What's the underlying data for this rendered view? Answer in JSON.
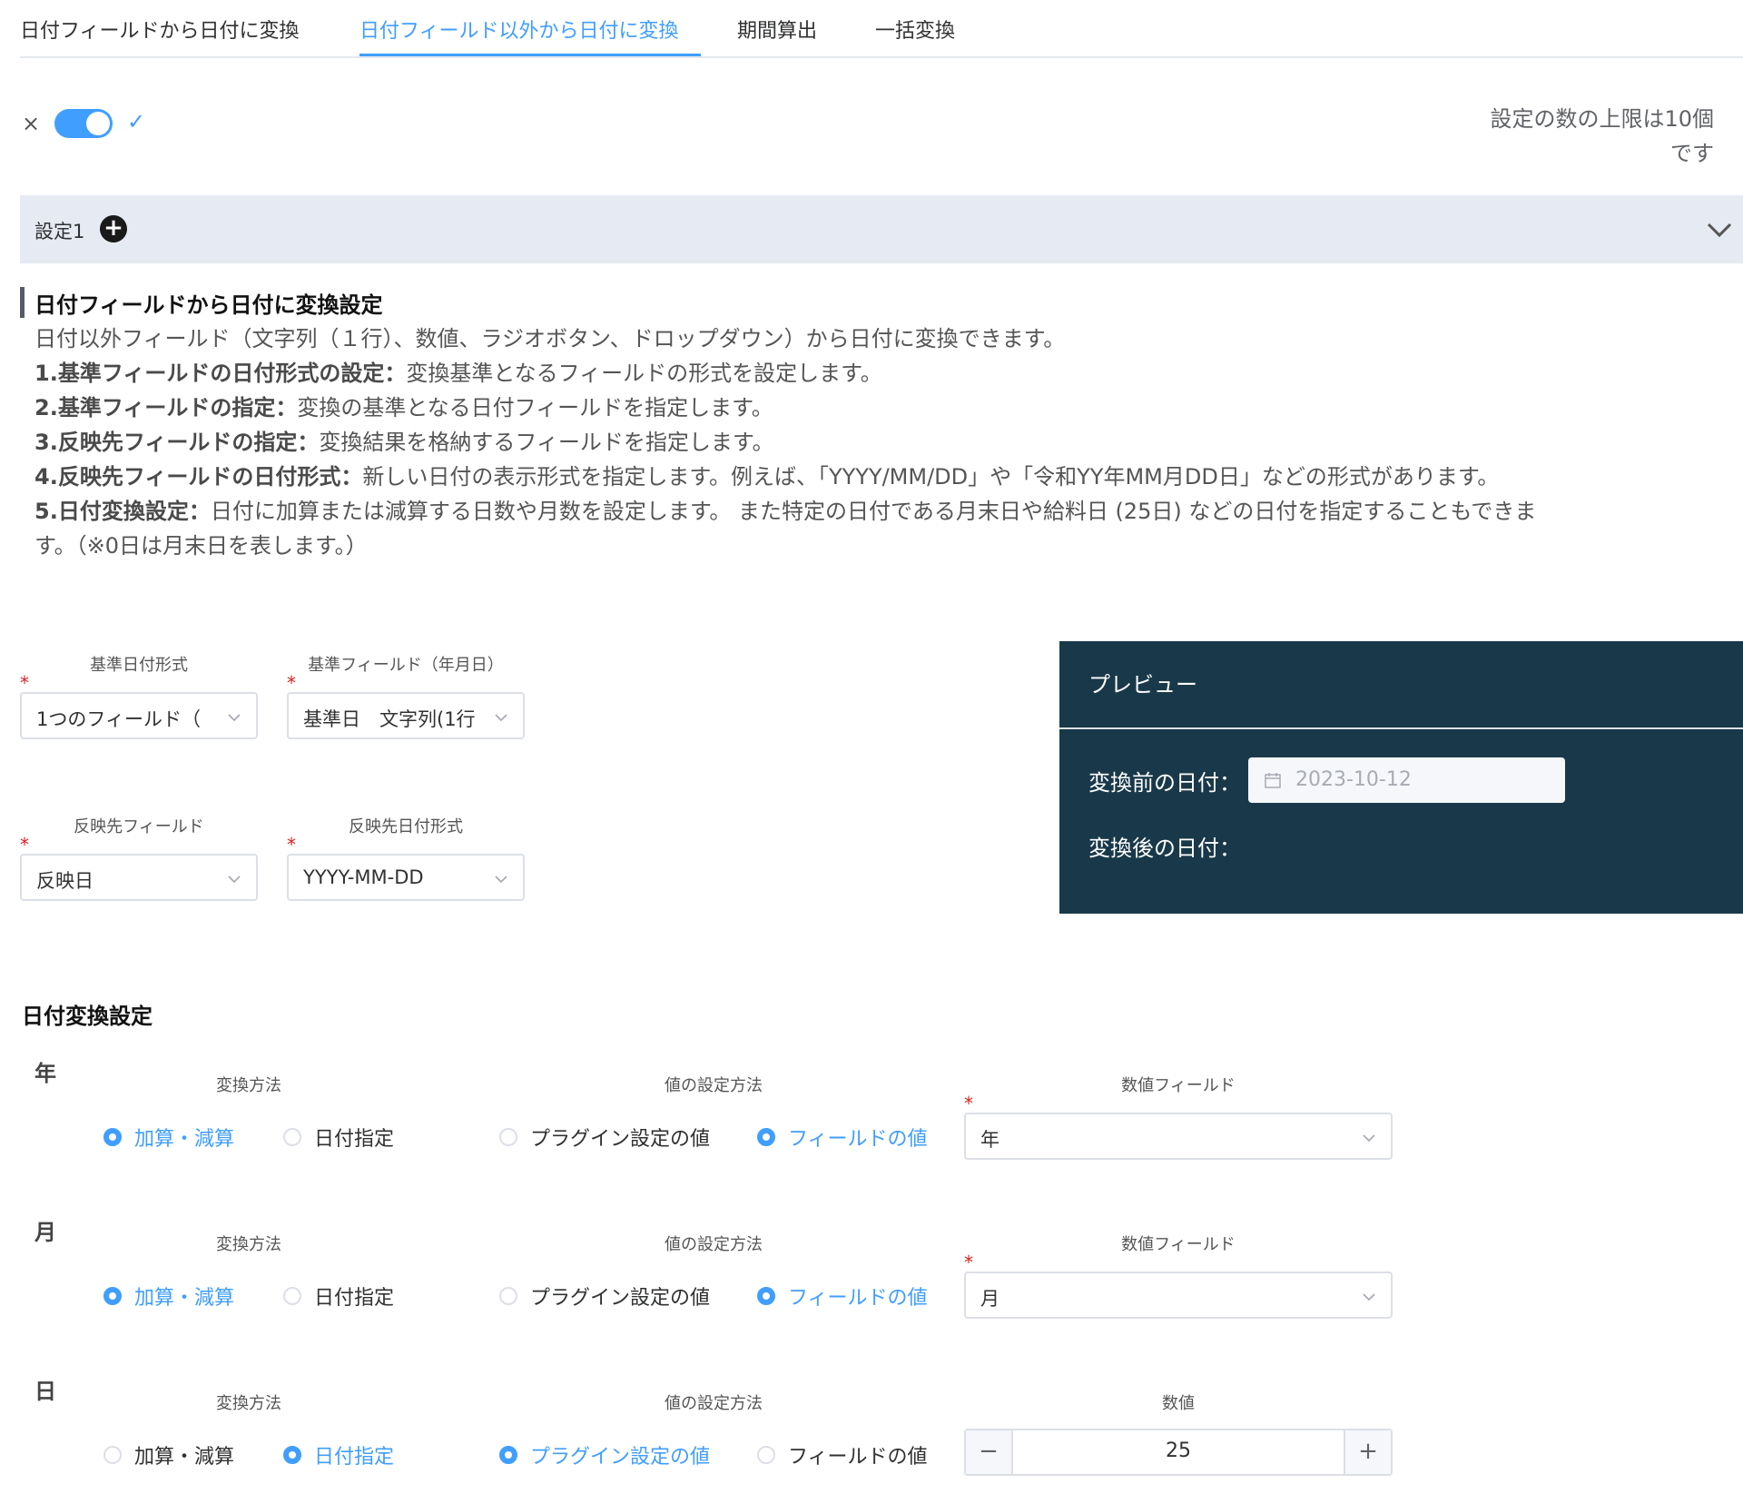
{
  "tabs": [
    {
      "label": "日付フィールドから日付に変換"
    },
    {
      "label": "日付フィールド以外から日付に変換"
    },
    {
      "label": "期間算出"
    },
    {
      "label": "一括変換"
    }
  ],
  "toggle": {
    "off_mark": "×",
    "on_mark": "✓",
    "enabled": true
  },
  "limit_text": {
    "line1": "設定の数の上限は10個",
    "line2": "です"
  },
  "setting": {
    "title": "設定1"
  },
  "description": {
    "title": "日付フィールドから日付に変換設定",
    "intro": "日付以外フィールド（文字列（１行）、数値、ラジオボタン、ドロップダウン）から日付に変換できます。",
    "items": [
      {
        "head": "1.基準フィールドの日付形式の設定：",
        "body": "変換基準となるフィールドの形式を設定します。"
      },
      {
        "head": "2.基準フィールドの指定：",
        "body": "変換の基準となる日付フィールドを指定します。"
      },
      {
        "head": "3.反映先フィールドの指定：",
        "body": "変換結果を格納するフィールドを指定します。"
      },
      {
        "head": "4.反映先フィールドの日付形式：",
        "body": "新しい日付の表示形式を指定します。例えば、「YYYY/MM/DD」や「令和YY年MM月DD日」などの形式があります。"
      },
      {
        "head": "5.日付変換設定：",
        "body": "日付に加算または減算する日数や月数を設定します。 また特定の日付である月末日や給料日 (25日) などの日付を指定することもできま"
      }
    ],
    "tail": "す。（※0日は月末日を表します。）"
  },
  "form": {
    "base_format": {
      "label": "基準日付形式",
      "value": "1つのフィールド（"
    },
    "base_field": {
      "label": "基準フィールド（年月日）",
      "value": "基準日　文字列(1行"
    },
    "target_field": {
      "label": "反映先フィールド",
      "value": "反映日"
    },
    "target_format": {
      "label": "反映先日付形式",
      "value": "YYYY-MM-DD"
    }
  },
  "preview": {
    "title": "プレビュー",
    "before_label": "変換前の日付：",
    "before_placeholder": "2023-10-12",
    "after_label": "変換後の日付："
  },
  "conversion": {
    "title": "日付変換設定",
    "rows": [
      {
        "unit": "年",
        "method_label": "変換方法",
        "method_options": [
          "加算・減算",
          "日付指定"
        ],
        "method_selected": 0,
        "value_label": "値の設定方法",
        "value_options": [
          "プラグイン設定の値",
          "フィールドの値"
        ],
        "value_selected": 1,
        "field_label": "数値フィールド",
        "field_value": "年"
      },
      {
        "unit": "月",
        "method_label": "変換方法",
        "method_options": [
          "加算・減算",
          "日付指定"
        ],
        "method_selected": 0,
        "value_label": "値の設定方法",
        "value_options": [
          "プラグイン設定の値",
          "フィールドの値"
        ],
        "value_selected": 1,
        "field_label": "数値フィールド",
        "field_value": "月"
      },
      {
        "unit": "日",
        "method_label": "変換方法",
        "method_options": [
          "加算・減算",
          "日付指定"
        ],
        "method_selected": 1,
        "value_label": "値の設定方法",
        "value_options": [
          "プラグイン設定の値",
          "フィールドの値"
        ],
        "value_selected": 0,
        "field_label": "数値",
        "number_value": "25",
        "minus": "−",
        "plus": "+"
      }
    ]
  },
  "colors": {
    "accent": "#409eff",
    "preview_bg": "#19394a",
    "header_bg": "#e6eaf2",
    "required": "#e02020"
  }
}
